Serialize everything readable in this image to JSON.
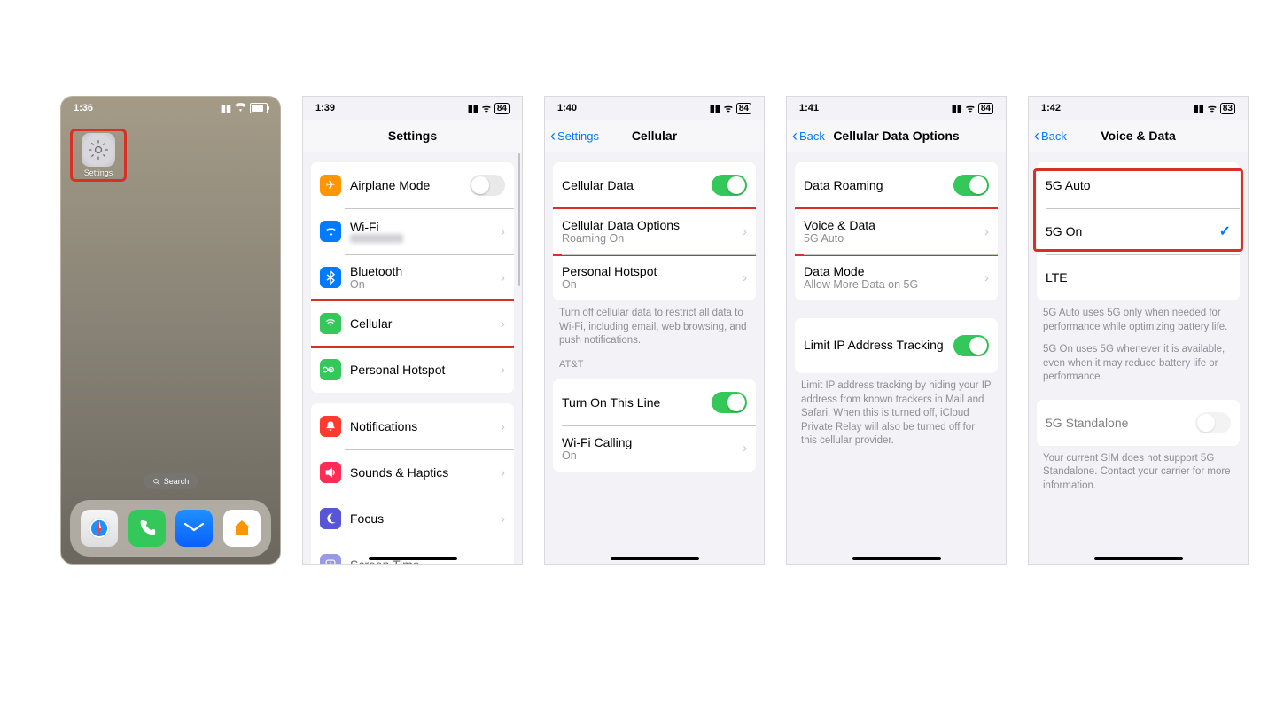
{
  "home": {
    "time": "1:36",
    "battery": "84",
    "settings_label": "Settings",
    "search": "Search"
  },
  "settings": {
    "time": "1:39",
    "battery": "84",
    "title": "Settings",
    "airplane": "Airplane Mode",
    "wifi_label": "Wi-Fi",
    "wifi_value": " ",
    "bluetooth_label": "Bluetooth",
    "bluetooth_value": "On",
    "cellular": "Cellular",
    "hotspot": "Personal Hotspot",
    "notifications": "Notifications",
    "sounds": "Sounds & Haptics",
    "focus": "Focus",
    "screentime": "Screen Time"
  },
  "cellular": {
    "time": "1:40",
    "battery": "84",
    "back": "Settings",
    "title": "Cellular",
    "cellular_data": "Cellular Data",
    "cdo_label": "Cellular Data Options",
    "cdo_value": "Roaming On",
    "hotspot_label": "Personal Hotspot",
    "hotspot_value": "On",
    "footer1": "Turn off cellular data to restrict all data to Wi-Fi, including email, web browsing, and push notifications.",
    "carrier_header": "AT&T",
    "turn_on_line": "Turn On This Line",
    "wifi_calling_label": "Wi-Fi Calling",
    "wifi_calling_value": "On"
  },
  "cdo": {
    "time": "1:41",
    "battery": "84",
    "back": "Back",
    "title": "Cellular Data Options",
    "data_roaming": "Data Roaming",
    "voice_data_label": "Voice & Data",
    "voice_data_value": "5G Auto",
    "data_mode_label": "Data Mode",
    "data_mode_value": "Allow More Data on 5G",
    "limit_ip": "Limit IP Address Tracking",
    "footer": "Limit IP address tracking by hiding your IP address from known trackers in Mail and Safari. When this is turned off, iCloud Private Relay will also be turned off for this cellular provider."
  },
  "voice": {
    "time": "1:42",
    "battery": "83",
    "back": "Back",
    "title": "Voice & Data",
    "opt_5g_auto": "5G Auto",
    "opt_5g_on": "5G On",
    "opt_lte": "LTE",
    "footer1": "5G Auto uses 5G only when needed for performance while optimizing battery life.",
    "footer2": "5G On uses 5G whenever it is available, even when it may reduce battery life or performance.",
    "standalone": "5G Standalone",
    "footer3": "Your current SIM does not support 5G Standalone. Contact your carrier for more information."
  }
}
